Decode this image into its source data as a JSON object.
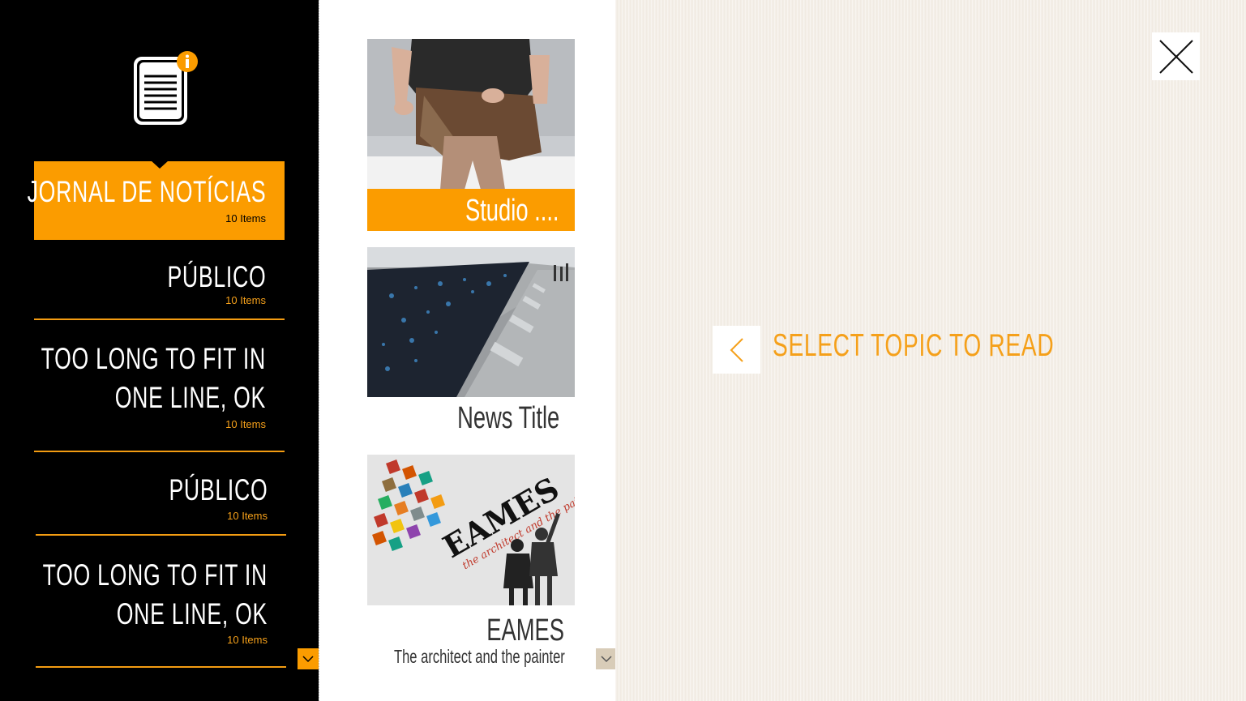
{
  "sidebar": {
    "app_icon": "news-document-icon",
    "info_badge_icon": "info-icon",
    "feeds": [
      {
        "title": "JORNAL DE NOTÍCIAS",
        "count": "10 Items",
        "selected": true
      },
      {
        "title": "PÚBLICO",
        "count": "10 Items",
        "selected": false
      },
      {
        "title": "TOO LONG TO FIT IN ONE LINE, OK",
        "count": "10 Items",
        "selected": false
      },
      {
        "title": "PÚBLICO",
        "count": "10 Items",
        "selected": false
      },
      {
        "title": "TOO LONG TO FIT IN ONE LINE, OK",
        "count": "10 Items",
        "selected": false
      }
    ],
    "scroll_icon": "chevron-down-icon"
  },
  "articles": {
    "items": [
      {
        "title": "Studio ....",
        "subtitle": "",
        "image": "woman-sitting-photo",
        "selected": true
      },
      {
        "title": "News Title",
        "subtitle": "",
        "image": "blue-mosaic-wall-photo",
        "selected": false
      },
      {
        "title": "EAMES",
        "subtitle": "The architect and the painter",
        "image": "eames-poster",
        "selected": false
      }
    ],
    "scroll_icon": "chevron-down-icon"
  },
  "reader": {
    "prompt": "SELECT TOPIC TO READ",
    "back_icon": "chevron-left-icon",
    "close_icon": "close-icon"
  },
  "colors": {
    "accent": "#fb9c00",
    "sidebar_bg": "#000000",
    "reader_bg": "#f4efe8"
  }
}
